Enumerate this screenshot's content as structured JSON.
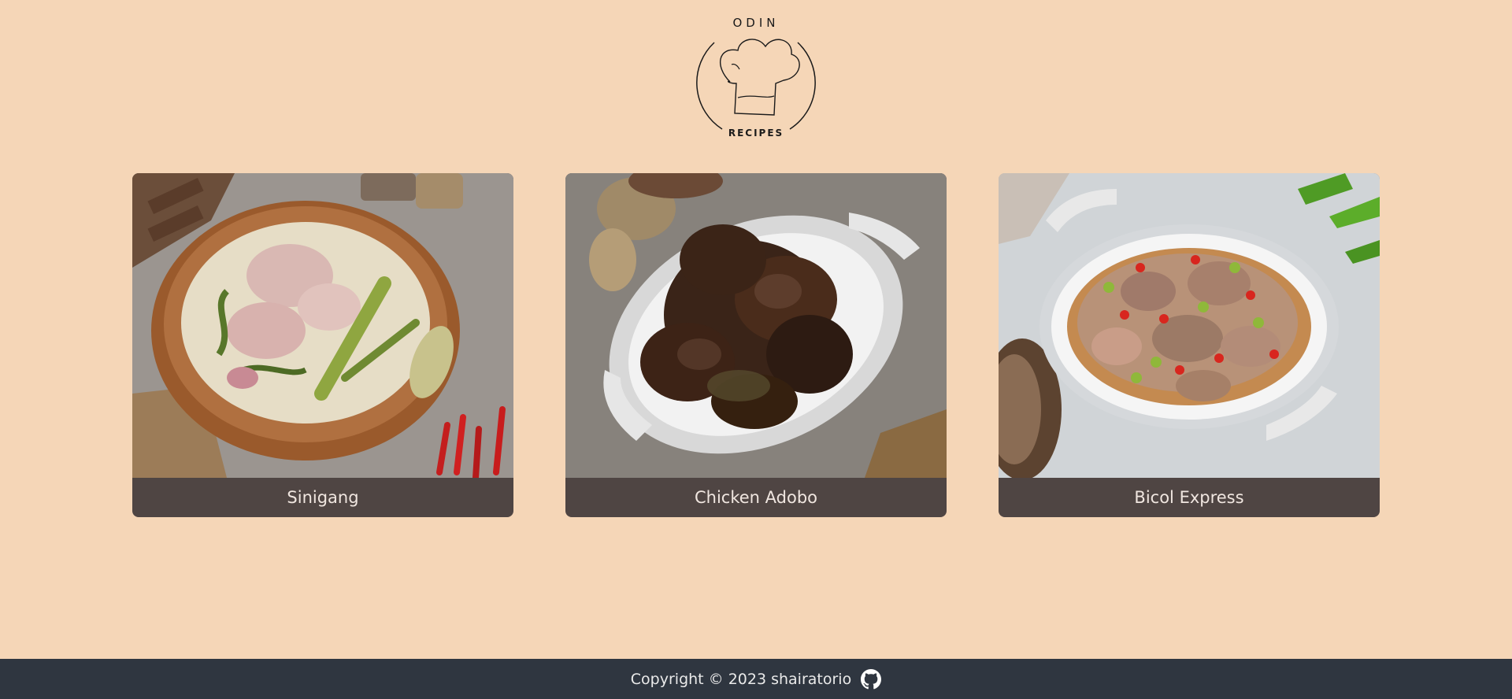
{
  "logo": {
    "top_text": "ODIN",
    "bottom_text": "RECIPES"
  },
  "cards": [
    {
      "label": "Sinigang",
      "image": "sinigang-soup-in-wooden-bowl"
    },
    {
      "label": "Chicken Adobo",
      "image": "chicken-adobo-in-white-dish"
    },
    {
      "label": "Bicol Express",
      "image": "bicol-express-in-white-dish"
    }
  ],
  "footer": {
    "copyright": "Copyright © 2023 shairatorio",
    "icon": "github-icon"
  },
  "colors": {
    "background": "#f5d6b7",
    "card_label_bg": "#4f4543",
    "footer_bg": "#2f3640"
  }
}
